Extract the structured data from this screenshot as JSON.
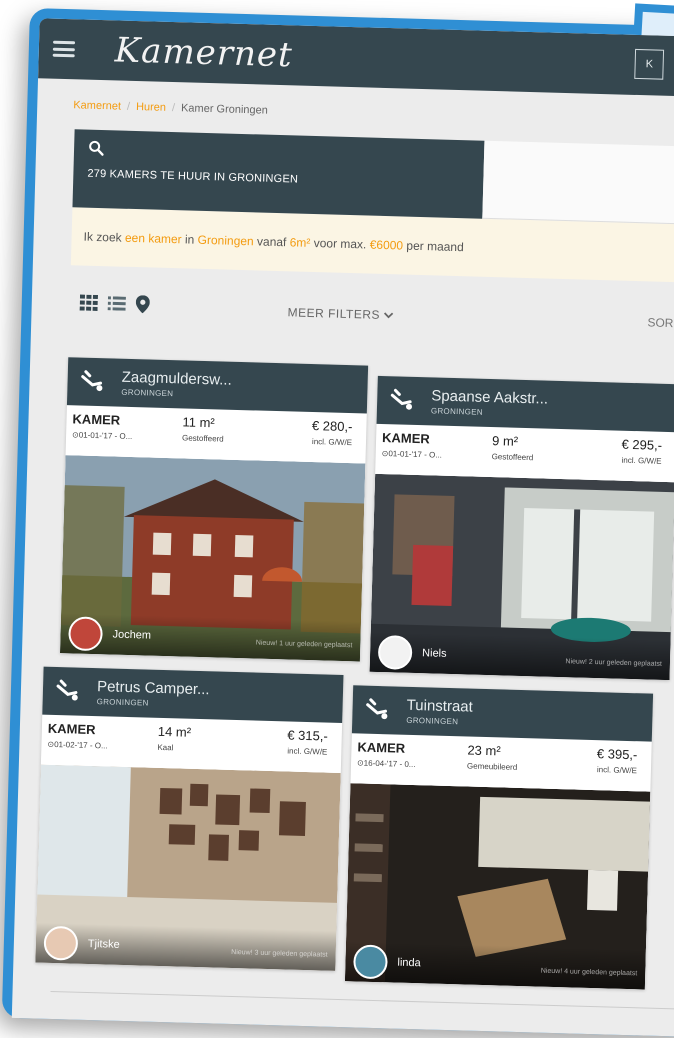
{
  "header": {
    "logo": "Kamernet",
    "login_label": "K"
  },
  "breadcrumb": {
    "items": [
      "Kamernet",
      "Huren",
      "Kamer Groningen"
    ],
    "separator": "/"
  },
  "search": {
    "count_label": "279 KAMERS TE HUUR IN GRONINGEN"
  },
  "query": {
    "p1": "Ik zoek ",
    "type": "een kamer",
    "p2": " in ",
    "city": "Groningen",
    "p3": " vanaf ",
    "size": "6m²",
    "p4": " voor max. ",
    "price": "€6000",
    "p5": " per maand"
  },
  "toolbar": {
    "filters_label": "MEER FILTERS",
    "sort_label": "SOR"
  },
  "colors": {
    "brand_dark": "#35474f",
    "accent": "#f39c12",
    "frame": "#2f8fd4"
  },
  "listings": [
    {
      "street": "Zaagmuldersw...",
      "city": "GRONINGEN",
      "type": "KAMER",
      "date": "⊙01-01-'17 - O...",
      "size": "11 m²",
      "furnishing": "Gestoffeerd",
      "price": "€ 280,-",
      "price_note": "incl. G/W/E",
      "agent": "Jochem",
      "posted": "Nieuw! 1 uur geleden geplaatst"
    },
    {
      "street": "Spaanse Aakstr...",
      "city": "GRONINGEN",
      "type": "KAMER",
      "date": "⊙01-01-'17 - O...",
      "size": "9 m²",
      "furnishing": "Gestoffeerd",
      "price": "€ 295,-",
      "price_note": "incl. G/W/E",
      "agent": "Niels",
      "posted": "Nieuw! 2 uur geleden geplaatst"
    },
    {
      "street": "Petrus Camper...",
      "city": "GRONINGEN",
      "type": "KAMER",
      "date": "⊙01-02-'17 - O...",
      "size": "14 m²",
      "furnishing": "Kaal",
      "price": "€ 315,-",
      "price_note": "incl. G/W/E",
      "agent": "Tjitske",
      "posted": "Nieuw! 3 uur geleden geplaatst"
    },
    {
      "street": "Tuinstraat",
      "city": "GRONINGEN",
      "type": "KAMER",
      "date": "⊙16-04-'17 - 0...",
      "size": "23 m²",
      "furnishing": "Gemeubileerd",
      "price": "€ 395,-",
      "price_note": "incl. G/W/E",
      "agent": "linda",
      "posted": "Nieuw! 4 uur geleden geplaatst"
    }
  ]
}
